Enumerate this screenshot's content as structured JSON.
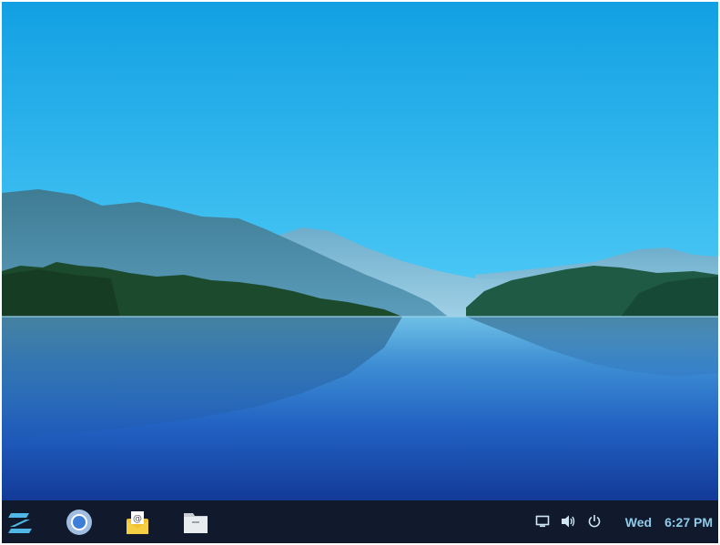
{
  "clock": {
    "day": "Wed",
    "time": "6:27 PM"
  },
  "taskbar": {
    "launchers": [
      {
        "name": "zorin-menu-icon"
      },
      {
        "name": "chromium-browser-icon"
      },
      {
        "name": "mail-client-icon"
      },
      {
        "name": "files-icon"
      }
    ],
    "tray": [
      {
        "name": "display-icon"
      },
      {
        "name": "volume-icon"
      },
      {
        "name": "power-icon"
      }
    ]
  },
  "colors": {
    "taskbar_bg": "#111a2c",
    "clock_text": "#8fcbea",
    "sky_top": "#12a3e6",
    "lake": "#1a4fb0"
  }
}
